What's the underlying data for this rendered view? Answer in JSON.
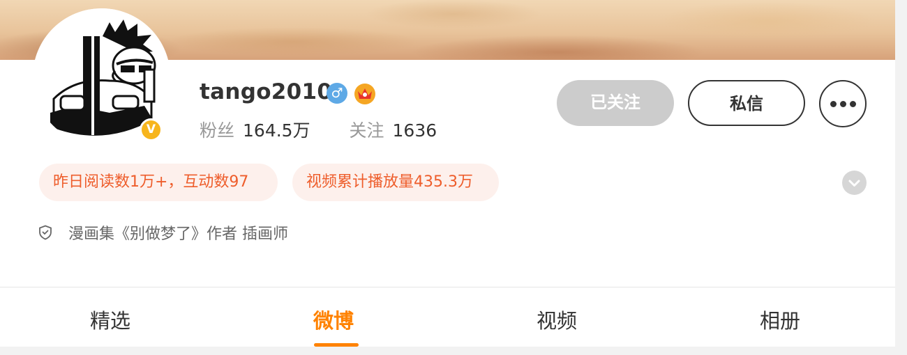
{
  "profile": {
    "username": "tango2010",
    "gender_symbol": "♂",
    "verified_symbol": "V",
    "stats": {
      "fans_label": "粉丝",
      "fans_value": "164.5万",
      "following_label": "关注",
      "following_value": "1636"
    },
    "bio": "漫画集《别做梦了》作者 插画师"
  },
  "actions": {
    "followed_label": "已关注",
    "message_label": "私信"
  },
  "highlights": {
    "reads": "昨日阅读数1万+，互动数97",
    "video_plays": "视频累计播放量435.3万"
  },
  "tabs": [
    {
      "label": "精选",
      "active": false
    },
    {
      "label": "微博",
      "active": true
    },
    {
      "label": "视频",
      "active": false
    },
    {
      "label": "相册",
      "active": false
    }
  ],
  "colors": {
    "accent": "#ff8200",
    "highlight_text": "#ee5d2b",
    "highlight_bg": "#fdf0ec",
    "verified_badge": "#f7b51c",
    "gender_icon": "#5ea9e6",
    "followed_button": "#cccccc"
  },
  "icons": {
    "gender": "male-icon",
    "vip": "vip-crown-icon",
    "verified": "verified-badge-icon",
    "more": "more-dots-icon",
    "expand": "chevron-down-icon",
    "bio": "shield-icon"
  }
}
